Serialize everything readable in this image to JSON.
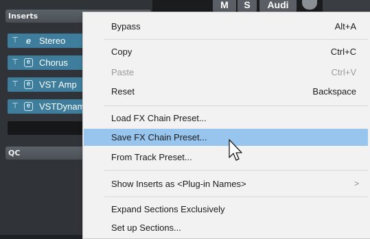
{
  "mixer": {
    "inserts_header": "Inserts",
    "qc_header": "QC",
    "slots": [
      {
        "name": "Stereo",
        "icon": "e-icon-plain"
      },
      {
        "name": "Chorus",
        "icon": "e-icon-boxed"
      },
      {
        "name": "VST Amp",
        "icon": "e-icon-boxed"
      },
      {
        "name": "VSTDynamics",
        "icon": "e-icon-boxed"
      }
    ],
    "pin_glyph": "⊤",
    "edit_glyph_plain": "e",
    "edit_glyph_boxed": "e",
    "strip_buttons": {
      "mute": "M",
      "solo": "S",
      "audio": "Audi"
    }
  },
  "context_menu": {
    "items": [
      {
        "label": "Bypass",
        "shortcut": "Alt+A",
        "enabled": true
      },
      {
        "label": "Copy",
        "shortcut": "Ctrl+C",
        "enabled": true
      },
      {
        "label": "Paste",
        "shortcut": "Ctrl+V",
        "enabled": false
      },
      {
        "label": "Reset",
        "shortcut": "Backspace",
        "enabled": true
      },
      {
        "label": "Load FX Chain Preset...",
        "shortcut": "",
        "enabled": true
      },
      {
        "label": "Save FX Chain Preset...",
        "shortcut": "",
        "enabled": true,
        "highlighted": true
      },
      {
        "label": "From Track Preset...",
        "shortcut": "",
        "enabled": true
      },
      {
        "label": "Show Inserts as <Plug-in Names>",
        "shortcut": "",
        "enabled": true,
        "submenu_arrow": ">"
      },
      {
        "label": "Expand Sections Exclusively",
        "shortcut": "",
        "enabled": true
      },
      {
        "label": "Set up Sections...",
        "shortcut": "",
        "enabled": true
      }
    ]
  },
  "colors": {
    "highlight": "#98c5ed",
    "slot_accent": "#3e7e9c",
    "menu_bg": "#f2f2f2"
  }
}
